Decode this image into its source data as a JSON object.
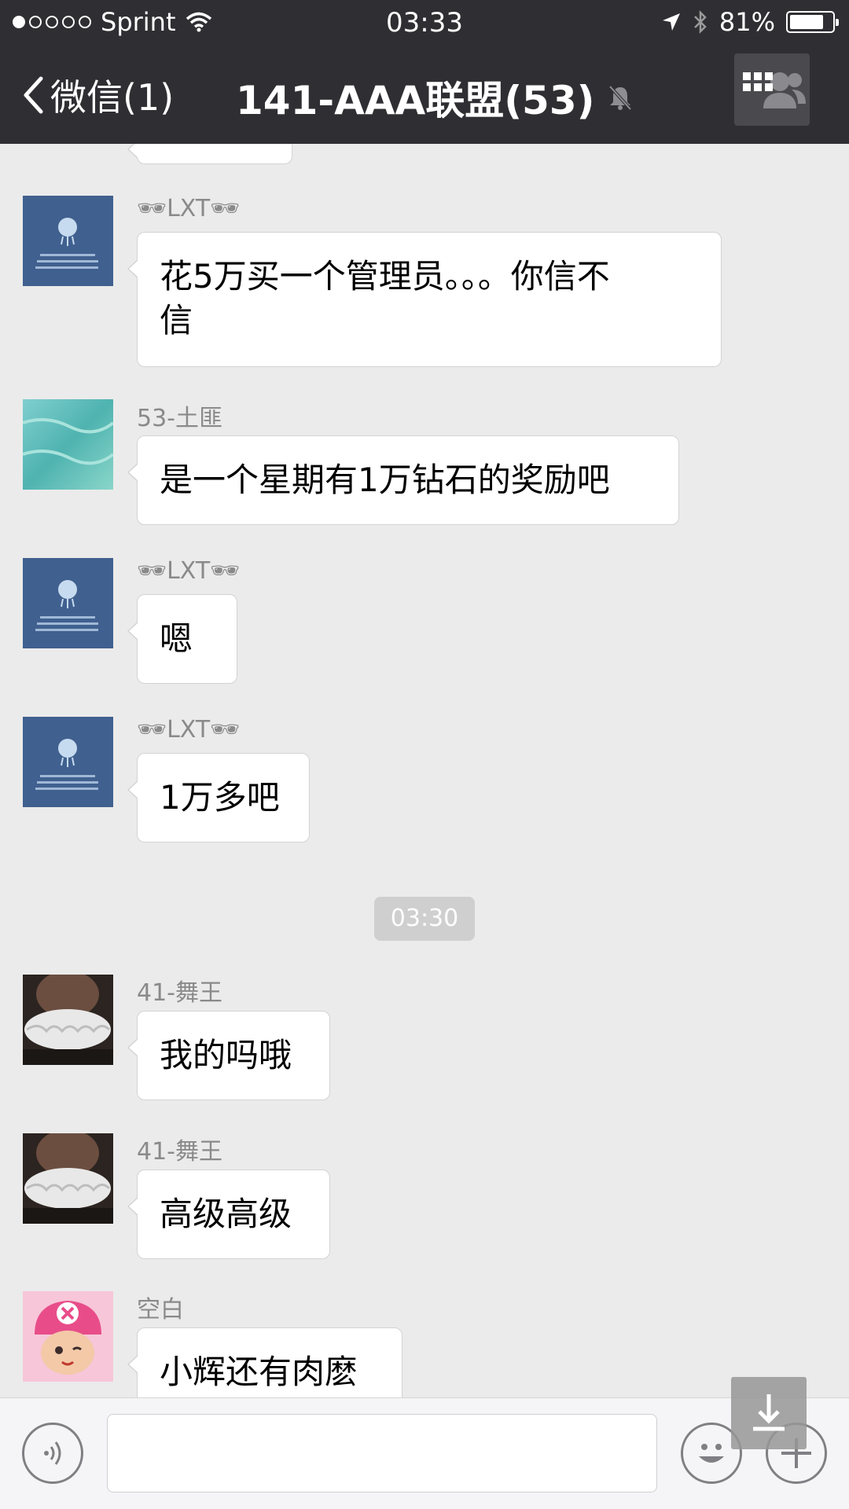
{
  "status_bar": {
    "carrier": "Sprint",
    "time": "03:33",
    "battery": "81%",
    "battery_level": 0.81,
    "signal_bars_filled": 1,
    "signal_bars_total": 5
  },
  "nav": {
    "back_label": "微信(1)",
    "title": "141-AAA联盟(53)"
  },
  "messages": [
    {
      "sender": "🕶LXT🕶",
      "text_line1": "花5万买一个管理员。。。你信不",
      "text_line2": "信",
      "avatar": "jellyfish-avatar"
    },
    {
      "sender": "53-土匪",
      "text": "是一个星期有1万钻石的奖励吧",
      "avatar": "water-avatar"
    },
    {
      "sender": "🕶LXT🕶",
      "text": "嗯",
      "avatar": "jellyfish-avatar"
    },
    {
      "sender": "🕶LXT🕶",
      "text": "1万多吧",
      "avatar": "jellyfish-avatar"
    },
    {
      "sender": "41-舞王",
      "text": "我的吗哦",
      "avatar": "ruff-collar-avatar"
    },
    {
      "sender": "41-舞王",
      "text": "高级高级",
      "avatar": "ruff-collar-avatar"
    },
    {
      "sender": "空白",
      "text": "小辉还有肉麽",
      "avatar": "cartoon-avatar"
    }
  ],
  "timestamp_divider": "03:30",
  "colors": {
    "topbar": "#2f2f33",
    "chat_background": "#ebebeb",
    "bubble": "#ffffff",
    "timestamp_pill": "#cfcfcf"
  }
}
